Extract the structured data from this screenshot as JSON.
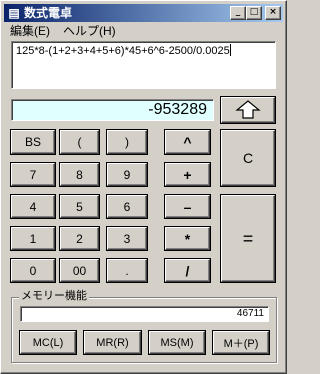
{
  "window": {
    "title": "数式電卓",
    "icon": "calculator-icon"
  },
  "titlebar_buttons": {
    "minimize": "_",
    "maximize": "□",
    "close": "×"
  },
  "menu": [
    {
      "label": "編集(E)"
    },
    {
      "label": "ヘルプ(H)"
    }
  ],
  "expression": "125*8-(1+2+3+4+5+6)*45+6^6-2500/0.0025",
  "result": "-953289",
  "keys": {
    "backspace": "BS",
    "lparen": "(",
    "rparen": ")",
    "pow": "^",
    "clear": "C",
    "k7": "7",
    "k8": "8",
    "k9": "9",
    "plus": "+",
    "k4": "4",
    "k5": "5",
    "k6": "6",
    "minus": "–",
    "k1": "1",
    "k2": "2",
    "k3": "3",
    "mul": "*",
    "equals": "=",
    "k0": "0",
    "k00": "00",
    "dot": ".",
    "div": "/"
  },
  "memory": {
    "label": "メモリー機能",
    "value": "46711",
    "buttons": {
      "mc": "MC(L)",
      "mr": "MR(R)",
      "ms": "MS(M)",
      "mplus": "M＋(P)"
    }
  }
}
